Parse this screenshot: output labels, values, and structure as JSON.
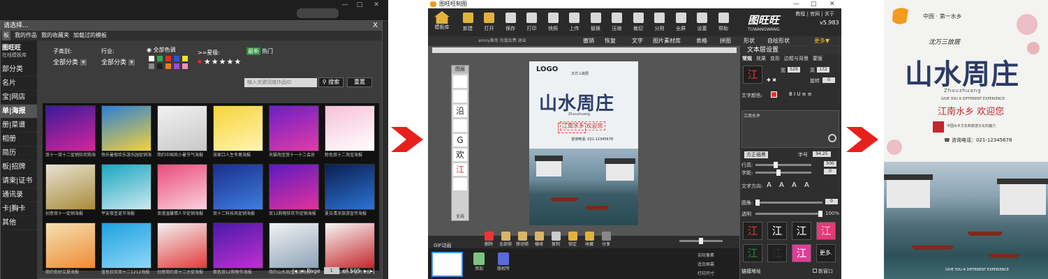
{
  "panel1": {
    "window_buttons": [
      "—",
      "□",
      "✕"
    ],
    "dialog_title": "请选择...",
    "dialog_close": "X",
    "tabs": [
      {
        "label": "板"
      },
      {
        "label": "我的作品"
      },
      {
        "label": "我的收藏夹"
      },
      {
        "label": "加载过的模板"
      }
    ],
    "brand": {
      "name": "图旺旺",
      "sub": "在线模板库"
    },
    "categories": [
      "部分类",
      "名片",
      "宝|网店",
      "单|海报",
      "册|菜谱",
      "相册",
      "简历",
      "板|招牌",
      "请柬|证书",
      "通讯录",
      "卡|胸卡",
      "其他"
    ],
    "filters": {
      "subcategory_label": "子类别:",
      "subcategory_value": "全部分类",
      "industry_label": "行业:",
      "industry_value": "全部分类",
      "color_label": "全部色调",
      "star_label": ">=星级:",
      "stars": "★★★★★",
      "tab_new": "最新",
      "tab_hot": "热门",
      "search_placeholder": "输入关键词或作品ID",
      "search_button": "搜索",
      "reset_button": "重置"
    },
    "swatches": [
      "#ffffff",
      "#2bb04a",
      "#e22a2a",
      "#2a58d8",
      "#f0e030",
      "#888888",
      "#222222",
      "#f07a18",
      "#9b4ad9",
      "#f28fb5"
    ],
    "templates": [
      {
        "caption": "双十一双十二促销狂欢购海报",
        "c1": "#3a1a9a",
        "c2": "#d7259b"
      },
      {
        "caption": "快乐暑假欢乐游乐园促销海报",
        "c1": "#2c7fd6",
        "c2": "#f4d23a"
      },
      {
        "caption": "简约中国风小暑节气海报",
        "c1": "#f1f1f1",
        "c2": "#c8c8c8"
      },
      {
        "caption": "张家口人生冬奥海报",
        "c1": "#f5d43a",
        "c2": "#fff4b0"
      },
      {
        "caption": "天猫淘宝双十一十二会员",
        "c1": "#6a1fc6",
        "c2": "#e33ca6"
      },
      {
        "caption": "粉色双十二淘宝海报",
        "c1": "#f7c0d8",
        "c2": "#fff"
      },
      {
        "caption": "创意双十一促销海报",
        "c1": "#e7e2d2",
        "c2": "#a98c3a"
      },
      {
        "caption": "平安夜圣诞节海报",
        "c1": "#1ba7c0",
        "c2": "#cce8f0"
      },
      {
        "caption": "浪漫温馨情人节促销海报",
        "c1": "#ea4c7d",
        "c2": "#fbd1de"
      },
      {
        "caption": "双十二科技风促销海报",
        "c1": "#1b2f8c",
        "c2": "#3e7de0"
      },
      {
        "caption": "双12购物狂欢节促销海报",
        "c1": "#5c1bbd",
        "c2": "#e2329f"
      },
      {
        "caption": "夏日清凉旅游宣传海报",
        "c1": "#0b1e50",
        "c2": "#2c74d4"
      },
      {
        "caption": "简约你好立夏海报",
        "c1": "#f4e0b0",
        "c2": "#ef8b36"
      },
      {
        "caption": "蓝色狂欢双十二1212海报",
        "c1": "#1ea1e0",
        "c2": "#8fd7f7"
      },
      {
        "caption": "创意简约双十二大促海报",
        "c1": "#f2f2f2",
        "c2": "#e43a3a"
      },
      {
        "caption": "紫色双12购物节海报",
        "c1": "#4a1aa9",
        "c2": "#c12fd1"
      },
      {
        "caption": "简约山水周庄旅游海报",
        "c1": "#f2f2f2",
        "c2": "#8ea3b8"
      },
      {
        "caption": "中国风江南水乡宣传海报",
        "c1": "#f7f7f7",
        "c2": "#c4262a"
      }
    ],
    "pager": {
      "page_label": "Page",
      "page_value": "1",
      "of_label": "of 505"
    }
  },
  "panel2": {
    "app_title": "图旺旺制图",
    "top_links": "教程 | 官网 | 关于",
    "window_buttons": [
      "—",
      "□",
      "✕"
    ],
    "home_label": "模板库",
    "toolbar": [
      "新建",
      "打开",
      "保存",
      "打印",
      "快照",
      "上传",
      "替换",
      "压缩",
      "裁切",
      "分割",
      "全屏",
      "设置",
      "帮助"
    ],
    "brand": {
      "name": "图旺旺",
      "sub": "TUWANGWANG",
      "version": "v5.983"
    },
    "user_info": "amoy黄岛 充值会费 退出",
    "subtools": [
      "撤销",
      "恢复",
      "文字",
      "图片素材库",
      "表格",
      "拼图",
      "形状",
      "自绘形状",
      "更多▼"
    ],
    "layers_title": "图层",
    "layers": [
      "",
      "",
      "沿",
      "",
      "G",
      "欢",
      "江",
      ""
    ],
    "layers_footer": "全选",
    "poster": {
      "logo": "LOGO",
      "sub": "沉方三故居",
      "title": "山水周庄",
      "pinyin": "Zhouzhuang",
      "red": "江南水乡 欢迎您",
      "tel": "咨询电话: 021-12345678"
    },
    "bottom_tools": [
      "删除",
      "全部锁",
      "移动锁",
      "横排",
      "复制",
      "锁定",
      "收藏",
      "分享"
    ],
    "gif_label": "GIF动画",
    "page_buttons": [
      "添加",
      "版权所"
    ],
    "right_info": [
      "实际像素",
      "适合屏幕",
      "打印尺寸"
    ],
    "right_panel": {
      "title": "文本层设置",
      "tabs": [
        "常规",
        "效果",
        "变形",
        "边框与背景",
        "蒙版"
      ],
      "coords": {
        "x_label": "宽",
        "x": "529",
        "y_label": "高",
        "y": "172",
        "rot_label": "旋转",
        "rot": "0"
      },
      "color_label": "文字颜色:",
      "text_value": "江南水乡",
      "font_name": "方正细黑",
      "font_size_label": "字号",
      "font_size": "94.25",
      "line_label": "行高:",
      "line_val": "500",
      "spacing_label": "字距:",
      "spacing_val": "0",
      "direction_label": "文字方向:",
      "radius_label": "圆角:",
      "radius_val": "0",
      "opacity_label": "透明",
      "opacity_val": "100%",
      "opacity_percent": 100,
      "fx_labels": [
        "江",
        "江",
        "江",
        "江",
        "江",
        "江",
        "江"
      ],
      "more_label": "更多.",
      "link_label": "链接地址",
      "new_window": "新窗口"
    }
  },
  "panel3": {
    "top": "中国 · 第一水乡",
    "sub": "沈万三故居",
    "title": "山水周庄",
    "pinyin": "Zhouzhuang",
    "english": "GIVE YOU A DIFFERENT EXPERIENCE",
    "red": "江南水乡 欢迎您",
    "small": "中国水乡文化和旅游文化的魔力",
    "tel": "☎ 咨询电话：021-12345678",
    "bottom": "GIVE YOU A DIFFERENT EXPERIENCE"
  },
  "colors": {
    "arrow": "#e8201c",
    "accent": "#f29b1d"
  }
}
